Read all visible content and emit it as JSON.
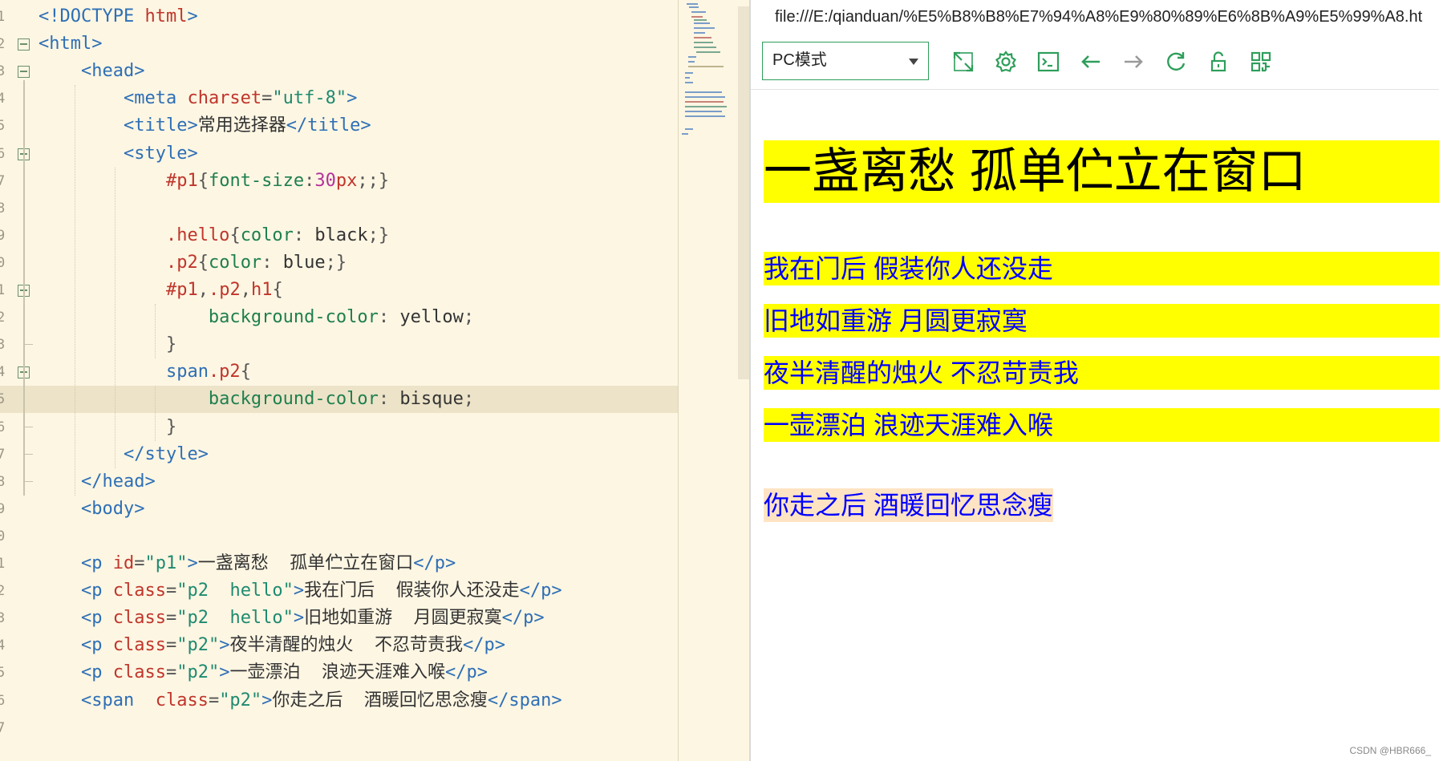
{
  "editor": {
    "lines": [
      {
        "n": "1",
        "parts": [
          [
            "t-tag",
            "<!DOCTYPE "
          ],
          [
            "t-kw",
            "html"
          ],
          [
            "t-tag",
            ">"
          ]
        ]
      },
      {
        "n": "2",
        "parts": [
          [
            "t-tag",
            "<html>"
          ]
        ]
      },
      {
        "n": "3",
        "parts": [
          [
            "t-txt",
            "    "
          ],
          [
            "t-tag",
            "<head>"
          ]
        ]
      },
      {
        "n": "4",
        "parts": [
          [
            "t-txt",
            "        "
          ],
          [
            "t-tag",
            "<meta "
          ],
          [
            "t-kw",
            "charset"
          ],
          [
            "t-punc",
            "="
          ],
          [
            "t-str",
            "\"utf-8\""
          ],
          [
            "t-tag",
            ">"
          ]
        ]
      },
      {
        "n": "5",
        "parts": [
          [
            "t-txt",
            "        "
          ],
          [
            "t-tag",
            "<title>"
          ],
          [
            "t-txt",
            "常用选择器"
          ],
          [
            "t-tag",
            "</title>"
          ]
        ]
      },
      {
        "n": "6",
        "parts": [
          [
            "t-txt",
            "        "
          ],
          [
            "t-tag",
            "<style>"
          ]
        ]
      },
      {
        "n": "7",
        "parts": [
          [
            "t-txt",
            "            "
          ],
          [
            "t-kw",
            "#p1"
          ],
          [
            "t-punc",
            "{"
          ],
          [
            "t-green",
            "font-size"
          ],
          [
            "t-punc",
            ":"
          ],
          [
            "t-num",
            "30"
          ],
          [
            "t-kw",
            "px"
          ],
          [
            "t-punc",
            ";;}"
          ]
        ]
      },
      {
        "n": "8",
        "parts": []
      },
      {
        "n": "9",
        "parts": [
          [
            "t-txt",
            "            "
          ],
          [
            "t-kw",
            ".hello"
          ],
          [
            "t-punc",
            "{"
          ],
          [
            "t-green",
            "color"
          ],
          [
            "t-punc",
            ": "
          ],
          [
            "t-txt",
            "black"
          ],
          [
            "t-punc",
            ";}"
          ]
        ]
      },
      {
        "n": "0",
        "parts": [
          [
            "t-txt",
            "            "
          ],
          [
            "t-kw",
            ".p2"
          ],
          [
            "t-punc",
            "{"
          ],
          [
            "t-green",
            "color"
          ],
          [
            "t-punc",
            ": "
          ],
          [
            "t-txt",
            "blue"
          ],
          [
            "t-punc",
            ";}"
          ]
        ]
      },
      {
        "n": "1",
        "parts": [
          [
            "t-txt",
            "            "
          ],
          [
            "t-kw",
            "#p1"
          ],
          [
            "t-punc",
            ","
          ],
          [
            "t-kw",
            ".p2"
          ],
          [
            "t-punc",
            ","
          ],
          [
            "t-kw",
            "h1"
          ],
          [
            "t-punc",
            "{"
          ]
        ]
      },
      {
        "n": "2",
        "parts": [
          [
            "t-txt",
            "                "
          ],
          [
            "t-green",
            "background-color"
          ],
          [
            "t-punc",
            ": "
          ],
          [
            "t-txt",
            "yellow"
          ],
          [
            "t-punc",
            ";"
          ]
        ]
      },
      {
        "n": "3",
        "parts": [
          [
            "t-txt",
            "            "
          ],
          [
            "t-punc",
            "}"
          ]
        ]
      },
      {
        "n": "4",
        "parts": [
          [
            "t-txt",
            "            "
          ],
          [
            "t-tag",
            "span"
          ],
          [
            "t-kw",
            ".p2"
          ],
          [
            "t-punc",
            "{"
          ]
        ]
      },
      {
        "n": "5",
        "parts": [
          [
            "t-txt",
            "                "
          ],
          [
            "t-green",
            "background-color"
          ],
          [
            "t-punc",
            ": "
          ],
          [
            "t-txt",
            "bisque"
          ],
          [
            "t-punc",
            ";"
          ]
        ]
      },
      {
        "n": "6",
        "parts": [
          [
            "t-txt",
            "            "
          ],
          [
            "t-punc",
            "}"
          ]
        ]
      },
      {
        "n": "7",
        "parts": [
          [
            "t-txt",
            "        "
          ],
          [
            "t-tag",
            "</style>"
          ]
        ]
      },
      {
        "n": "8",
        "parts": [
          [
            "t-txt",
            "    "
          ],
          [
            "t-tag",
            "</head>"
          ]
        ]
      },
      {
        "n": "9",
        "parts": [
          [
            "t-txt",
            "    "
          ],
          [
            "t-tag",
            "<body>"
          ]
        ]
      },
      {
        "n": "0",
        "parts": []
      },
      {
        "n": "1",
        "parts": [
          [
            "t-txt",
            "    "
          ],
          [
            "t-tag",
            "<p "
          ],
          [
            "t-kw",
            "id"
          ],
          [
            "t-punc",
            "="
          ],
          [
            "t-str",
            "\"p1\""
          ],
          [
            "t-tag",
            ">"
          ],
          [
            "t-txt",
            "一盏离愁  孤单伫立在窗口"
          ],
          [
            "t-tag",
            "</p>"
          ]
        ]
      },
      {
        "n": "2",
        "parts": [
          [
            "t-txt",
            "    "
          ],
          [
            "t-tag",
            "<p "
          ],
          [
            "t-kw",
            "class"
          ],
          [
            "t-punc",
            "="
          ],
          [
            "t-str",
            "\"p2  hello\""
          ],
          [
            "t-tag",
            ">"
          ],
          [
            "t-txt",
            "我在门后  假装你人还没走"
          ],
          [
            "t-tag",
            "</p>"
          ]
        ]
      },
      {
        "n": "3",
        "parts": [
          [
            "t-txt",
            "    "
          ],
          [
            "t-tag",
            "<p "
          ],
          [
            "t-kw",
            "class"
          ],
          [
            "t-punc",
            "="
          ],
          [
            "t-str",
            "\"p2  hello\""
          ],
          [
            "t-tag",
            ">"
          ],
          [
            "t-txt",
            "旧地如重游  月圆更寂寞"
          ],
          [
            "t-tag",
            "</p>"
          ]
        ]
      },
      {
        "n": "4",
        "parts": [
          [
            "t-txt",
            "    "
          ],
          [
            "t-tag",
            "<p "
          ],
          [
            "t-kw",
            "class"
          ],
          [
            "t-punc",
            "="
          ],
          [
            "t-str",
            "\"p2\""
          ],
          [
            "t-tag",
            ">"
          ],
          [
            "t-txt",
            "夜半清醒的烛火  不忍苛责我"
          ],
          [
            "t-tag",
            "</p>"
          ]
        ]
      },
      {
        "n": "5",
        "parts": [
          [
            "t-txt",
            "    "
          ],
          [
            "t-tag",
            "<p "
          ],
          [
            "t-kw",
            "class"
          ],
          [
            "t-punc",
            "="
          ],
          [
            "t-str",
            "\"p2\""
          ],
          [
            "t-tag",
            ">"
          ],
          [
            "t-txt",
            "一壶漂泊  浪迹天涯难入喉"
          ],
          [
            "t-tag",
            "</p>"
          ]
        ]
      },
      {
        "n": "6",
        "parts": [
          [
            "t-txt",
            "    "
          ],
          [
            "t-tag",
            "<span  "
          ],
          [
            "t-kw",
            "class"
          ],
          [
            "t-punc",
            "="
          ],
          [
            "t-str",
            "\"p2\""
          ],
          [
            "t-tag",
            ">"
          ],
          [
            "t-txt",
            "你走之后  酒暖回忆思念瘦"
          ],
          [
            "t-tag",
            "</span>"
          ]
        ]
      },
      {
        "n": "7",
        "parts": []
      }
    ]
  },
  "browser": {
    "url": "file:///E:/qianduan/%E5%B8%B8%E7%94%A8%E9%80%89%E6%8B%A9%E5%99%A8.ht",
    "mode": "PC模式",
    "icons": [
      "expand-icon",
      "settings-icon",
      "terminal-icon",
      "back-icon",
      "forward-icon",
      "reload-icon",
      "unlock-icon",
      "qrcode-icon"
    ]
  },
  "preview": {
    "p1": "一盏离愁 孤单伫立在窗口",
    "p2_items": [
      "我在门后 假装你人还没走",
      "旧地如重游 月圆更寂寞",
      "夜半清醒的烛火 不忍苛责我",
      "一壶漂泊 浪迹天涯难入喉"
    ],
    "span": "你走之后 酒暖回忆思念瘦"
  },
  "watermark": "CSDN @HBR666_",
  "colors": {
    "editor_bg": "#fdf6e3",
    "current_line": "#ede3c8",
    "accent": "#2e9e5b",
    "highlight_yellow": "#ffff00",
    "bisque": "#ffe4c4",
    "text_blue": "#0000ff"
  }
}
